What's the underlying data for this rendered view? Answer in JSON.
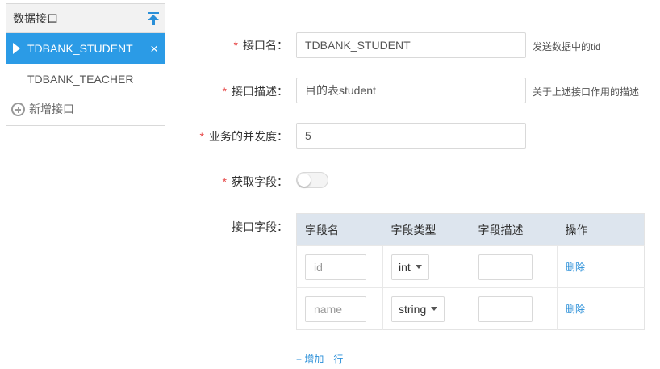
{
  "sidebar": {
    "title": "数据接口",
    "items": [
      {
        "label": "TDBANK_STUDENT",
        "active": true,
        "close": "×"
      },
      {
        "label": "TDBANK_TEACHER",
        "active": false
      }
    ],
    "add_label": "新增接口"
  },
  "form": {
    "required_mark": "*",
    "name": {
      "label": "接口名：",
      "value": "TDBANK_STUDENT",
      "hint": "发送数据中的tid"
    },
    "desc": {
      "label": "接口描述：",
      "value": "目的表student",
      "hint": "关于上述接口作用的描述"
    },
    "concurrency": {
      "label": "业务的并发度：",
      "value": "5"
    },
    "fetch_fields": {
      "label": "获取字段：",
      "on": false
    },
    "fields": {
      "label": "接口字段：",
      "headers": [
        "字段名",
        "字段类型",
        "字段描述",
        "操作"
      ],
      "rows": [
        {
          "name_placeholder": "id",
          "type": "int",
          "desc": "",
          "action": "删除"
        },
        {
          "name_placeholder": "name",
          "type": "string",
          "desc": "",
          "action": "删除"
        }
      ],
      "add_row": "+ 增加一行"
    }
  },
  "colors": {
    "accent": "#2b9be6",
    "link": "#2a8fd8",
    "required": "#e64545",
    "table_header": "#dde5ee"
  }
}
